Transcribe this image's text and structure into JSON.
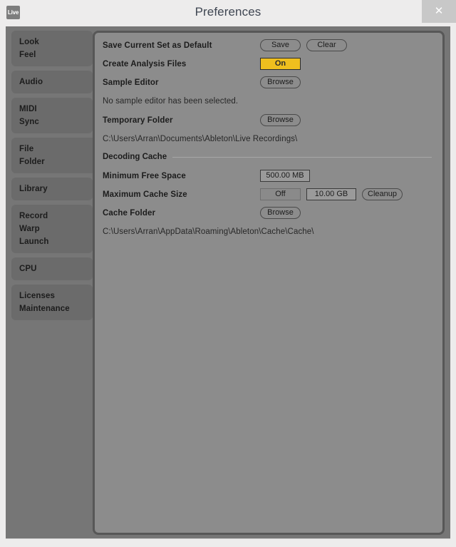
{
  "window": {
    "title": "Preferences",
    "logo_text": "Live",
    "close_label": "✕"
  },
  "sidebar": {
    "items": [
      {
        "lines": [
          "Look",
          "Feel"
        ],
        "selected": false
      },
      {
        "lines": [
          "Audio"
        ],
        "selected": false
      },
      {
        "lines": [
          "MIDI",
          "Sync"
        ],
        "selected": false
      },
      {
        "lines": [
          "File",
          "Folder"
        ],
        "selected": true
      },
      {
        "lines": [
          "Library"
        ],
        "selected": false
      },
      {
        "lines": [
          "Record",
          "Warp",
          "Launch"
        ],
        "selected": false
      },
      {
        "lines": [
          "CPU"
        ],
        "selected": false
      },
      {
        "lines": [
          "Licenses",
          "Maintenance"
        ],
        "selected": false
      }
    ]
  },
  "main": {
    "rows": {
      "save_default": {
        "label": "Save Current Set as Default",
        "save_label": "Save",
        "clear_label": "Clear"
      },
      "analysis_files": {
        "label": "Create Analysis Files",
        "toggle_value": "On"
      },
      "sample_editor": {
        "label": "Sample Editor",
        "browse_label": "Browse",
        "note": "No sample editor has been selected."
      },
      "temporary_folder": {
        "label": "Temporary Folder",
        "browse_label": "Browse",
        "path": "C:\\Users\\Arran\\Documents\\Ableton\\Live Recordings\\"
      }
    },
    "decoding_cache": {
      "section_title": "Decoding Cache",
      "minimum_free_space": {
        "label": "Minimum Free Space",
        "value": "500.00 MB"
      },
      "maximum_cache_size": {
        "label": "Maximum Cache Size",
        "state": "Off",
        "value": "10.00 GB",
        "cleanup_label": "Cleanup"
      },
      "cache_folder": {
        "label": "Cache Folder",
        "browse_label": "Browse",
        "path": "C:\\Users\\Arran\\AppData\\Roaming\\Ableton\\Cache\\Cache\\"
      }
    }
  },
  "colors": {
    "accent_on": "#efbf1e",
    "panel_bg": "#8c8c8c",
    "frame_bg": "#767676",
    "titlebar_bg": "#edecec"
  }
}
